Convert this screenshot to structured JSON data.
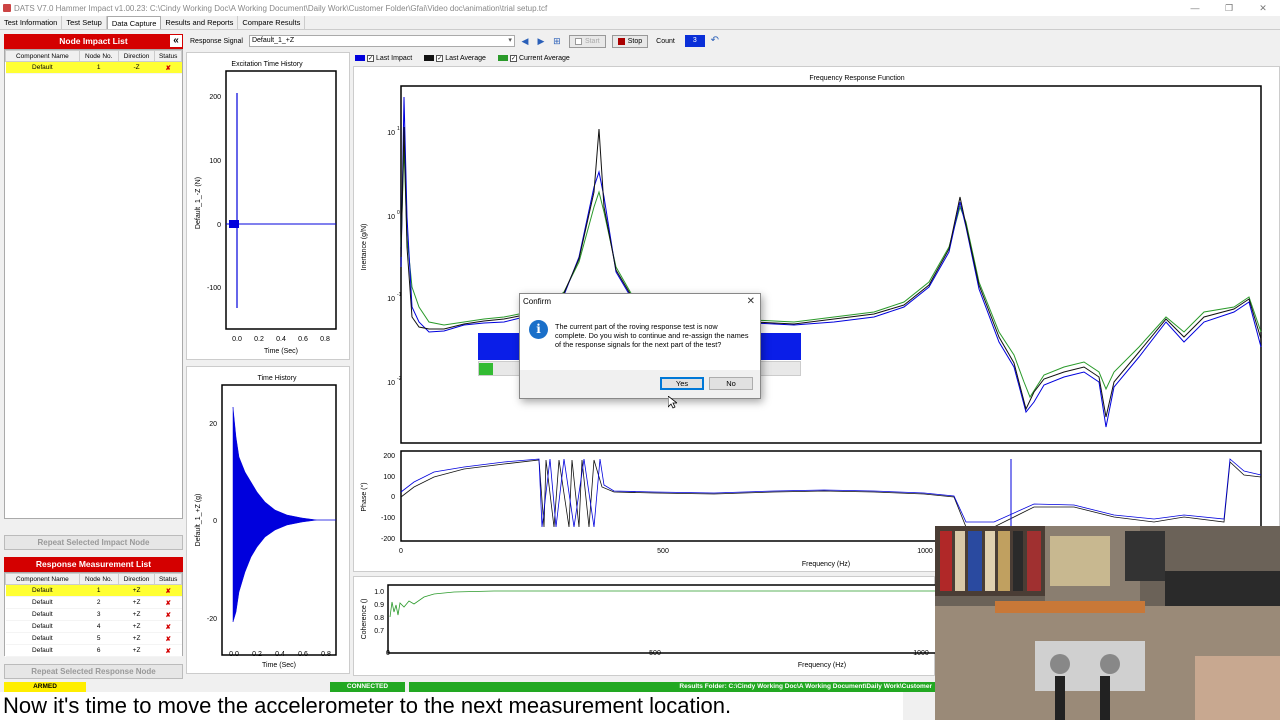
{
  "window": {
    "title": "DATS V7.0 Hammer Impact v1.00.23: C:\\Cindy Working Doc\\A Working Document\\Daily Work\\Customer Folder\\Gfai\\Video doc\\animation\\trial setup.tcf",
    "controls": [
      "—",
      "❐",
      "✕"
    ]
  },
  "menu_tabs": [
    "Test Information",
    "Test Setup",
    "Data Capture",
    "Results and Reports",
    "Compare Results"
  ],
  "active_tab": "Data Capture",
  "impact_list": {
    "title": "Node Impact List",
    "collapse_glyph": "«",
    "columns": [
      "Component Name",
      "Node No.",
      "Direction",
      "Status"
    ],
    "rows": [
      {
        "component": "Default",
        "node": "1",
        "direction": "-Z",
        "status": "✘"
      }
    ],
    "repeat_button": "Repeat Selected Impact Node"
  },
  "response_list": {
    "title": "Response Measurement List",
    "columns": [
      "Component Name",
      "Node No.",
      "Direction",
      "Status"
    ],
    "rows": [
      {
        "component": "Default",
        "node": "1",
        "direction": "+Z",
        "status": "✘"
      },
      {
        "component": "Default",
        "node": "2",
        "direction": "+Z",
        "status": "✘"
      },
      {
        "component": "Default",
        "node": "3",
        "direction": "+Z",
        "status": "✘"
      },
      {
        "component": "Default",
        "node": "4",
        "direction": "+Z",
        "status": "✘"
      },
      {
        "component": "Default",
        "node": "5",
        "direction": "+Z",
        "status": "✘"
      },
      {
        "component": "Default",
        "node": "6",
        "direction": "+Z",
        "status": "✘"
      }
    ],
    "repeat_button": "Repeat Selected Response Node"
  },
  "toolbar": {
    "response_signal_label": "Response Signal",
    "response_signal_value": "Default_1_+Z",
    "start_label": "Start",
    "stop_label": "Stop",
    "count_label": "Count",
    "count_value": "3"
  },
  "legend": [
    {
      "label": "Last Impact",
      "color": "#0000dd"
    },
    {
      "label": "Last Average",
      "color": "#111111"
    },
    {
      "label": "Current Average",
      "color": "#2a9a2a"
    }
  ],
  "charts": {
    "excitation": {
      "title": "Excitation Time History",
      "ylabel": "Default_1_-Z (N)",
      "xlabel": "Time (Sec)",
      "yticks": [
        "200",
        "100",
        "0",
        "-100"
      ],
      "xticks": [
        "0.0",
        "0.2",
        "0.4",
        "0.6",
        "0.8"
      ]
    },
    "time_history": {
      "title": "Time History",
      "ylabel": "Default_1_+Z (g)",
      "xlabel": "Time (Sec)",
      "yticks": [
        "20",
        "0",
        "-20"
      ],
      "xticks": [
        "0.0",
        "0.2",
        "0.4",
        "0.6",
        "0.8"
      ]
    },
    "frf": {
      "title": "Frequency Response Function",
      "ylabel": "Inertance (g/N)",
      "yticks": [
        "10",
        "10",
        "10",
        "10"
      ],
      "yexps": [
        "1",
        "0",
        "-1",
        "-2"
      ]
    },
    "phase": {
      "ylabel": "Phase (°)",
      "xlabel": "Frequency  (Hz)",
      "yticks": [
        "200",
        "100",
        "0",
        "-100",
        "-200"
      ],
      "xticks": [
        "0",
        "500",
        "1000"
      ]
    },
    "coherence": {
      "ylabel": "Coherence ()",
      "xlabel": "Frequency  (Hz)",
      "yticks": [
        "1.0",
        "0.9",
        "0.8",
        "0.7"
      ],
      "xticks": [
        "0",
        "500",
        "1000"
      ]
    }
  },
  "dialog": {
    "title": "Confirm",
    "message": "The current part of the roving response test is now complete. Do you wish to continue and re-assign the names of the response signals for the next part of the test?",
    "yes": "Yes",
    "no": "No"
  },
  "status": {
    "armed": "ARMED",
    "connected": "CONNECTED",
    "results_folder": "Results Folder: C:\\Cindy Working Doc\\A Working Document\\Daily Work\\Customer"
  },
  "caption": "Now it's time to move the accelerometer to the next measurement location.",
  "colors": {
    "red_header": "#d40000",
    "selected_row": "#ffff33",
    "blue_trace": "#0000dd",
    "green_trace": "#2a9a2a"
  }
}
